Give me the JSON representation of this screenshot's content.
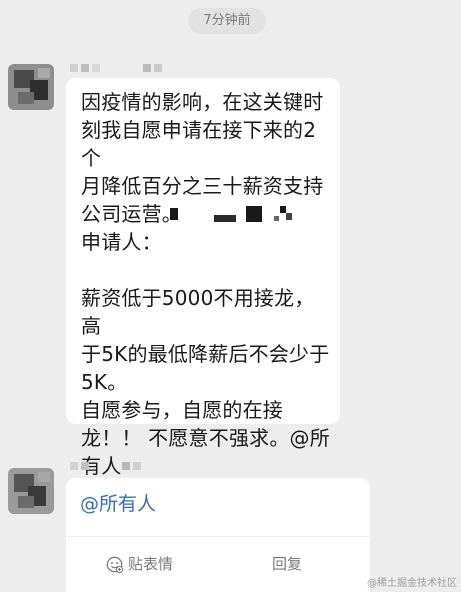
{
  "timestamp": "7分钟前",
  "message": {
    "text": "因疫情的影响，在这关键时\n刻我自愿申请在接下来的2个\n月降低百分之三十薪资支持\n公司运营。\n申请人：\n\n薪资低于5000不用接龙，高\n于5K的最低降薪后不会少于\n5K。\n自愿参与，自愿的在接\n龙！！ 不愿意不强求。@所\n有人"
  },
  "reply_card": {
    "mention": "@所有人",
    "sticker_label": "贴表情",
    "reply_label": "回复"
  },
  "icons": {
    "sticker": "sticker-icon"
  },
  "watermark": "@稀土掘金技术社区",
  "colors": {
    "background": "#EDEDED",
    "bubble": "#FFFFFF",
    "text": "#191919",
    "mention": "#3C6DB0",
    "muted": "#7A7A7A"
  }
}
